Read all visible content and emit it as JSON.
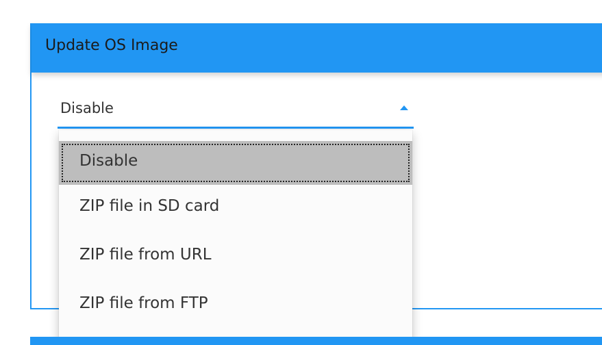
{
  "panel": {
    "title": "Update OS Image"
  },
  "select": {
    "current_value": "Disable",
    "options": [
      "Disable",
      "ZIP file in SD card",
      "ZIP file from URL",
      "ZIP file from FTP"
    ]
  },
  "colors": {
    "accent": "#2196f3",
    "selected_option_bg": "#bdbdbd",
    "dropdown_bg": "#fbfbfb",
    "text": "#333333"
  },
  "icons": {
    "select_caret": "caret-up-icon"
  }
}
